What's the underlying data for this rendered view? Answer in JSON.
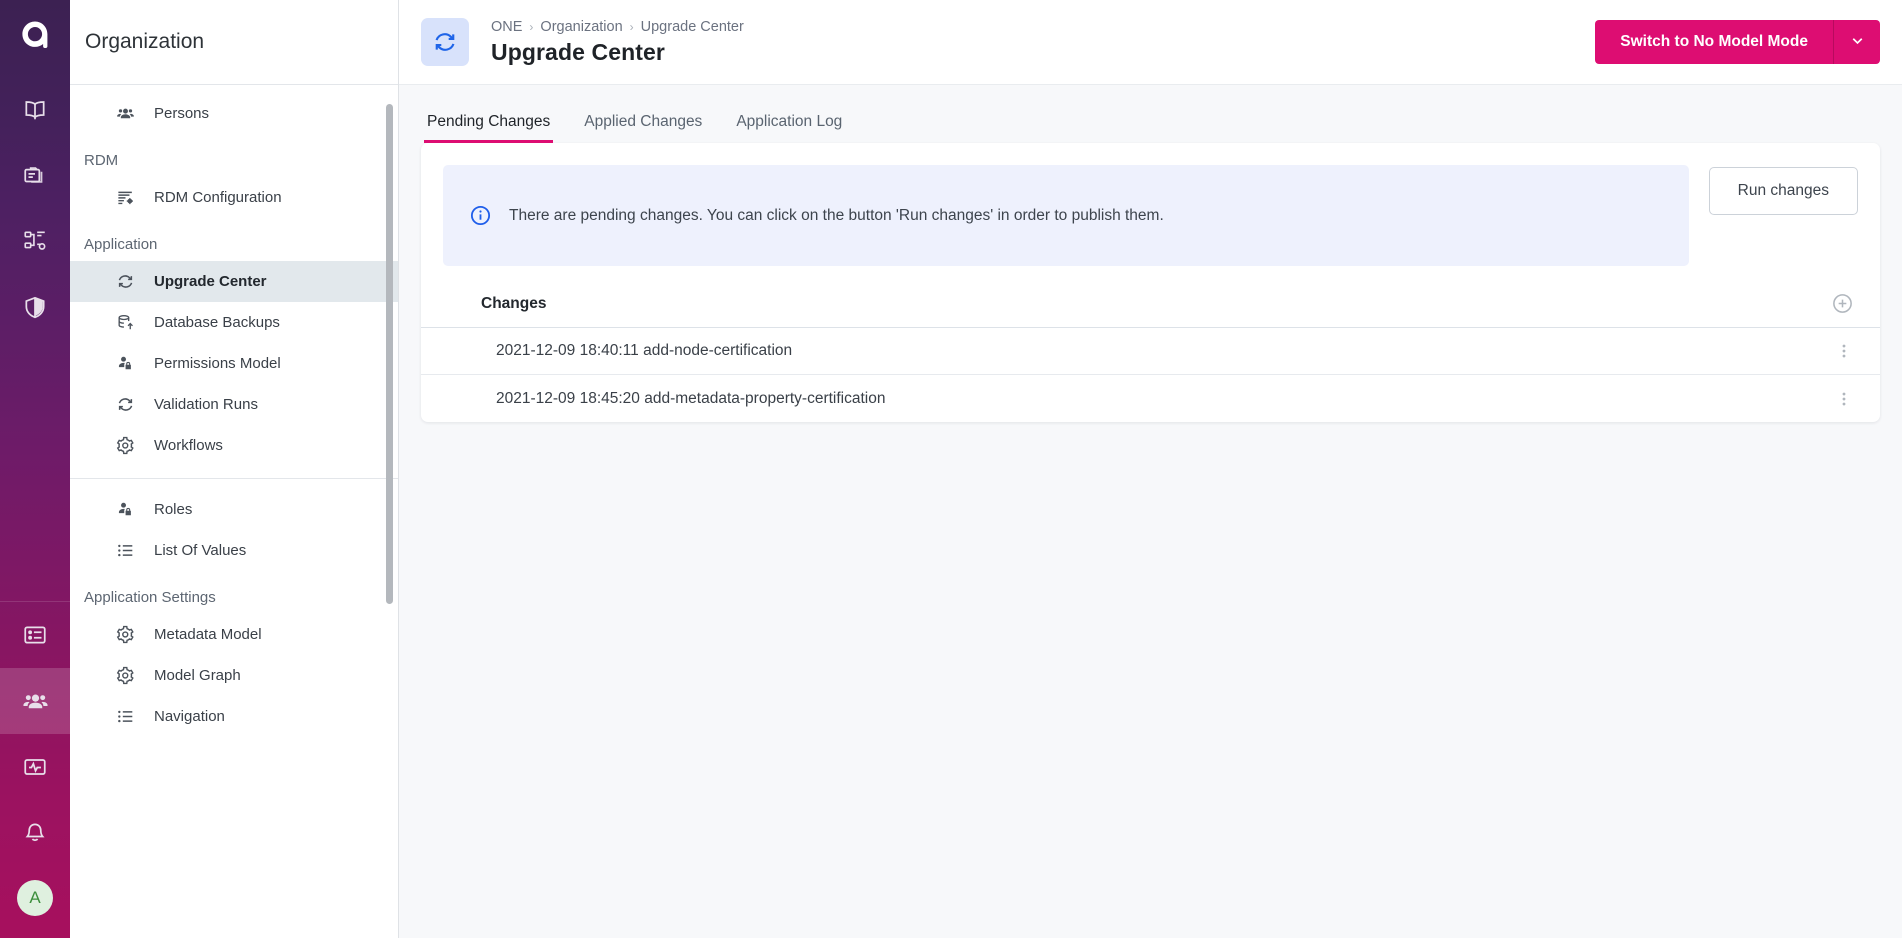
{
  "rail": {
    "logo_name": "ataccama-logo",
    "items": [
      {
        "icon": "book-icon",
        "name": "knowledge-catalog",
        "active": false
      },
      {
        "icon": "folders-icon",
        "name": "data-sources",
        "active": false
      },
      {
        "icon": "org-chart-icon",
        "name": "model-explorer",
        "active": false
      },
      {
        "icon": "shield-icon",
        "name": "data-quality",
        "active": false
      }
    ],
    "bottom_items": [
      {
        "icon": "list-box-icon",
        "name": "tasks",
        "active": false
      },
      {
        "icon": "people-icon",
        "name": "organization",
        "active": true
      },
      {
        "icon": "monitoring-icon",
        "name": "monitoring",
        "active": false
      },
      {
        "icon": "bell-icon",
        "name": "notifications",
        "active": false
      }
    ],
    "avatar_initial": "A"
  },
  "sidebar": {
    "title": "Organization",
    "sections": [
      {
        "label": null,
        "items": [
          {
            "label": "Persons",
            "icon": "people-icon",
            "active": false
          }
        ]
      },
      {
        "label": "RDM",
        "items": [
          {
            "label": "RDM Configuration",
            "icon": "rdm-config-icon",
            "active": false
          }
        ]
      },
      {
        "label": "Application",
        "items": [
          {
            "label": "Upgrade Center",
            "icon": "sync-icon",
            "active": true
          },
          {
            "label": "Database Backups",
            "icon": "database-backup-icon",
            "active": false
          },
          {
            "label": "Permissions Model",
            "icon": "person-lock-icon",
            "active": false
          },
          {
            "label": "Validation Runs",
            "icon": "sync-icon",
            "active": false
          },
          {
            "label": "Workflows",
            "icon": "gear-icon",
            "active": false
          }
        ]
      },
      {
        "label": null,
        "divider_before": true,
        "items": [
          {
            "label": "Roles",
            "icon": "person-lock-icon",
            "active": false
          },
          {
            "label": "List Of Values",
            "icon": "bullet-list-icon",
            "active": false
          }
        ]
      },
      {
        "label": "Application Settings",
        "items": [
          {
            "label": "Metadata Model",
            "icon": "gear-icon",
            "active": false
          },
          {
            "label": "Model Graph",
            "icon": "gear-icon",
            "active": false
          },
          {
            "label": "Navigation",
            "icon": "bullet-list-icon",
            "active": false
          }
        ]
      }
    ]
  },
  "header": {
    "page_icon": "sync-icon",
    "breadcrumb": [
      "ONE",
      "Organization",
      "Upgrade Center"
    ],
    "breadcrumb_separator": "›",
    "title": "Upgrade Center",
    "primary_button": {
      "label": "Switch to No Model Mode",
      "color": "#dd0d72",
      "dropdown_icon": "chevron-down-icon"
    }
  },
  "tabs": [
    {
      "label": "Pending Changes",
      "active": true
    },
    {
      "label": "Applied Changes",
      "active": false
    },
    {
      "label": "Application Log",
      "active": false
    }
  ],
  "banner": {
    "icon": "info-icon",
    "icon_color": "#1f5eea",
    "text": "There are pending changes. You can click on the button 'Run changes' in order to publish them.",
    "background": "#eef1fd"
  },
  "run_button": {
    "label": "Run changes"
  },
  "table": {
    "columns": [
      "Changes"
    ],
    "add_icon": "plus-circle-icon",
    "row_menu_icon": "kebab-menu-icon",
    "rows": [
      {
        "change": "2021-12-09 18:40:11 add-node-certification"
      },
      {
        "change": "2021-12-09 18:45:20 add-metadata-property-certification"
      }
    ]
  }
}
